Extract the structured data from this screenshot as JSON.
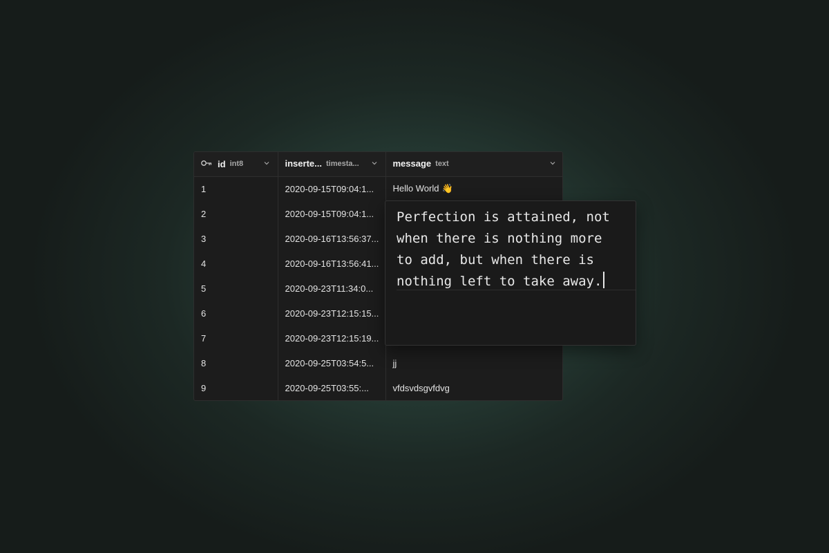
{
  "columns": {
    "id": {
      "name": "id",
      "type": "int8"
    },
    "inserted_at": {
      "name": "inserte...",
      "type": "timesta..."
    },
    "message": {
      "name": "message",
      "type": "text"
    }
  },
  "rows": [
    {
      "id": "1",
      "inserted_at": "2020-09-15T09:04:1...",
      "message": "Hello World",
      "emoji": "👋"
    },
    {
      "id": "2",
      "inserted_at": "2020-09-15T09:04:1...",
      "message": ""
    },
    {
      "id": "3",
      "inserted_at": "2020-09-16T13:56:37...",
      "message": ""
    },
    {
      "id": "4",
      "inserted_at": "2020-09-16T13:56:41...",
      "message": ""
    },
    {
      "id": "5",
      "inserted_at": "2020-09-23T11:34:0...",
      "message": ""
    },
    {
      "id": "6",
      "inserted_at": "2020-09-23T12:15:15...",
      "message": ""
    },
    {
      "id": "7",
      "inserted_at": "2020-09-23T12:15:19...",
      "message": ""
    },
    {
      "id": "8",
      "inserted_at": "2020-09-25T03:54:5...",
      "message": "jj"
    },
    {
      "id": "9",
      "inserted_at": "2020-09-25T03:55:...",
      "message": "vfdsvdsgvfdvg"
    }
  ],
  "editor": {
    "value": "Perfection is attained, not when there is nothing more to add, but when there is nothing left to take away."
  },
  "icons": {
    "primary_key": "key-icon",
    "column_menu": "chevron-down-icon"
  },
  "colors": {
    "background_center": "#2f4d43",
    "background_edge": "#161c1a",
    "grid_bg": "#1c1c1c",
    "border": "#2e2e2e",
    "text": "#ededed"
  }
}
